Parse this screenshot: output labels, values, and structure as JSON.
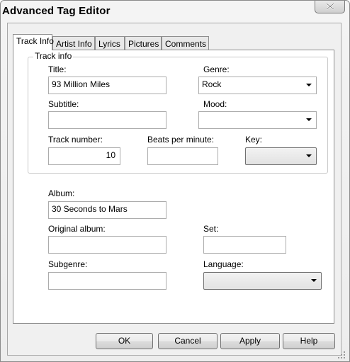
{
  "window": {
    "title": "Advanced Tag Editor"
  },
  "tabs": [
    "Track Info",
    "Artist Info",
    "Lyrics",
    "Pictures",
    "Comments"
  ],
  "active_tab": "Track Info",
  "track_info": {
    "group_label": "Track info",
    "title_label": "Title:",
    "title_value": "93 Million Miles",
    "genre_label": "Genre:",
    "genre_value": "Rock",
    "subtitle_label": "Subtitle:",
    "subtitle_value": "",
    "mood_label": "Mood:",
    "mood_value": "",
    "track_number_label": "Track number:",
    "track_number_value": "10",
    "bpm_label": "Beats per minute:",
    "bpm_value": "",
    "key_label": "Key:",
    "key_value": ""
  },
  "album": {
    "album_label": "Album:",
    "album_value": "30 Seconds to Mars",
    "original_album_label": "Original album:",
    "original_album_value": "",
    "set_label": "Set:",
    "set_value": "",
    "subgenre_label": "Subgenre:",
    "subgenre_value": "",
    "language_label": "Language:",
    "language_value": ""
  },
  "buttons": {
    "ok": "OK",
    "cancel": "Cancel",
    "apply": "Apply",
    "help": "Help"
  },
  "icons": {
    "close": "close-icon",
    "dropdown": "chevron-down-icon",
    "resize": "resize-grip-icon"
  }
}
